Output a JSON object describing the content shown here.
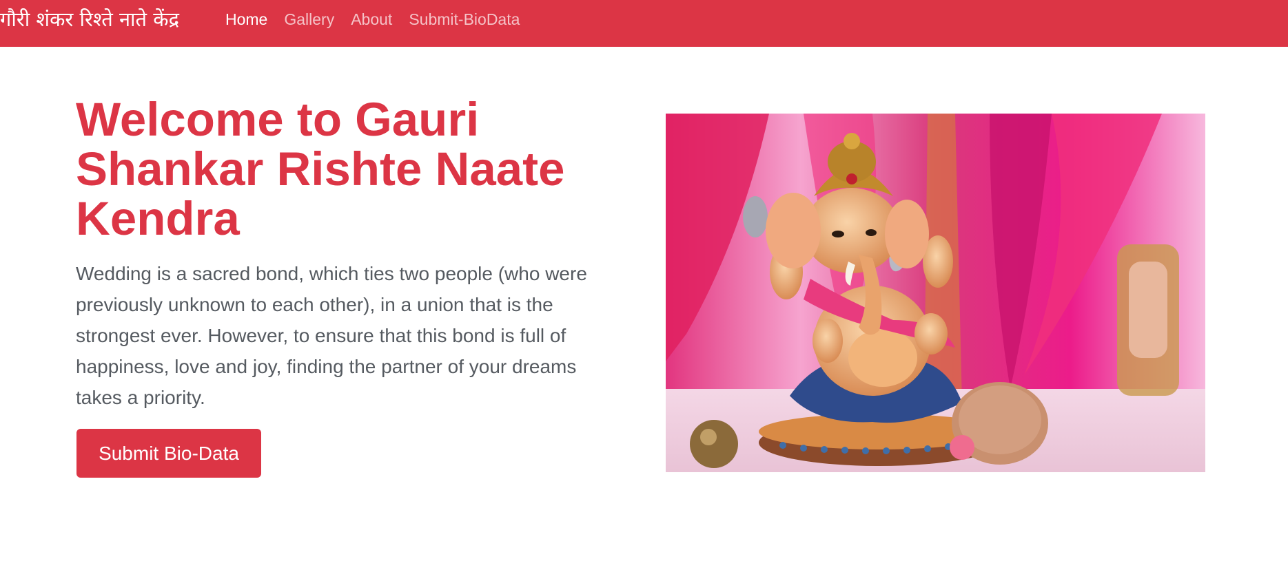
{
  "navbar": {
    "brand": "गौरी शंकर रिश्ते नाते केंद्र",
    "links": [
      {
        "label": "Home",
        "active": true
      },
      {
        "label": "Gallery"
      },
      {
        "label": "About"
      },
      {
        "label": "Submit-BioData"
      }
    ],
    "background": "#dc3545"
  },
  "hero": {
    "title": "Welcome to Gauri Shankar Rishte Naate Kendra",
    "description": "Wedding is a sacred bond, which ties two people (who were previously unknown to each other), in a union that is the strongest ever. However, to ensure that this bond is full of happiness, love and joy, finding the partner of your dreams takes a priority.",
    "cta_label": "Submit Bio-Data",
    "image_alt": "Ganesha idol on decorated wedding mandap",
    "accent_color": "#dc3545"
  }
}
